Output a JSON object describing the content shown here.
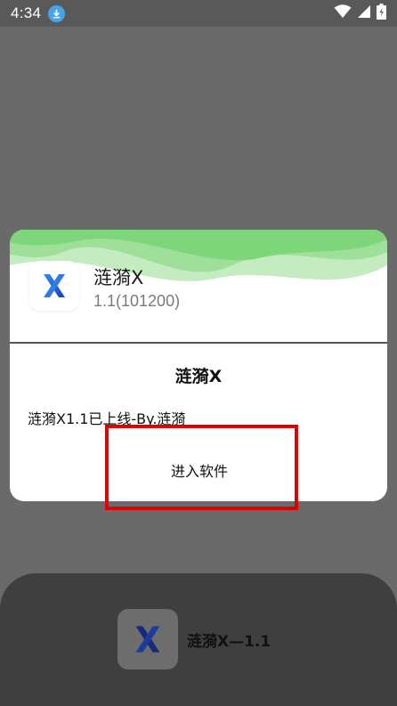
{
  "status_bar": {
    "time": "4:34",
    "icons": [
      "download-icon",
      "wifi-icon",
      "signal-icon",
      "battery-icon"
    ]
  },
  "dialog": {
    "app_name": "涟漪X",
    "app_version": "1.1(101200)",
    "title": "涟漪X",
    "message": "涟漪X1.1已上线-By.涟漪",
    "enter_label": "进入软件"
  },
  "bottom_card": {
    "title": "涟漪X—1.1"
  },
  "colors": {
    "wave_green": "#7ed67b",
    "accent_blue": "#1e5ee0",
    "highlight_red": "#e10000"
  }
}
